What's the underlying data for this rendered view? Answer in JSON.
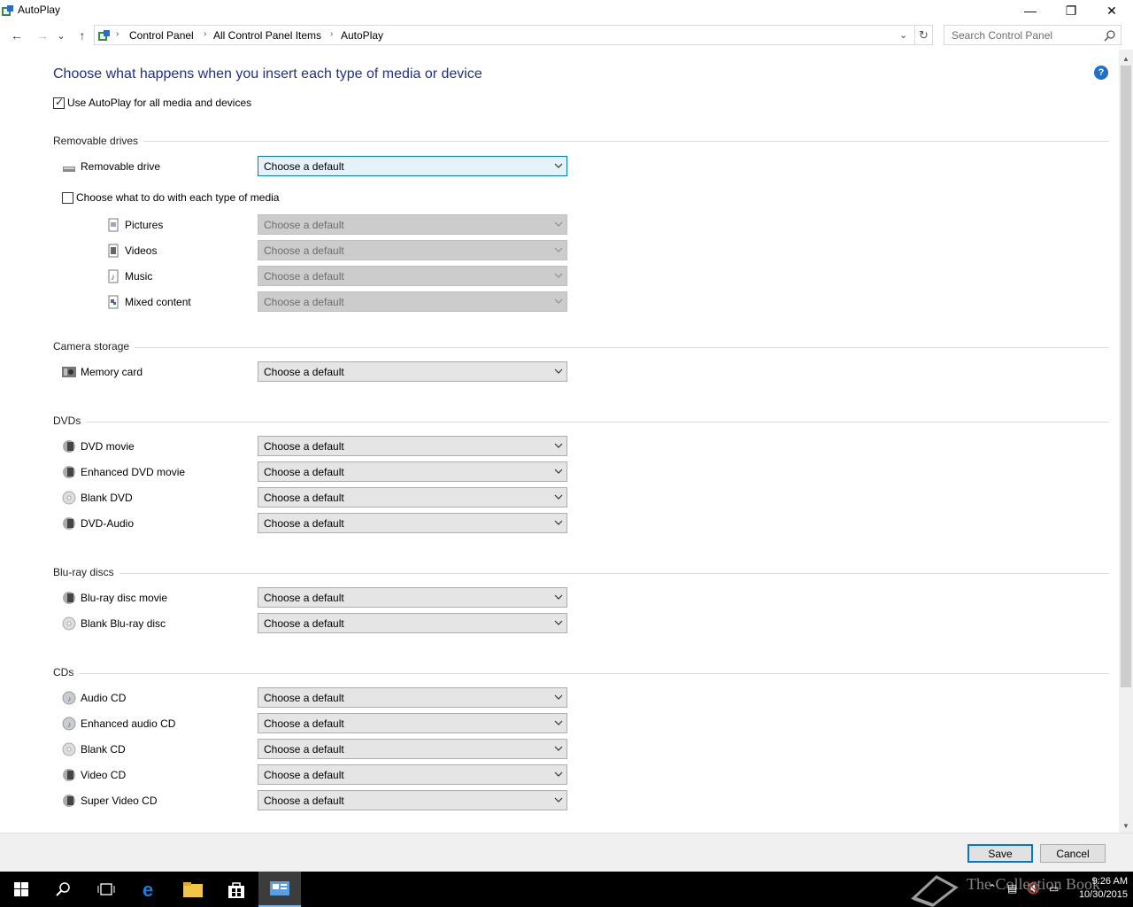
{
  "window": {
    "title": "AutoPlay",
    "minimize": "—",
    "maximize": "❐",
    "close": "✕"
  },
  "nav": {
    "back": "←",
    "forward": "→",
    "recent": "⌄",
    "up": "↑",
    "breadcrumbs": [
      "Control Panel",
      "All Control Panel Items",
      "AutoPlay"
    ],
    "refresh": "↻",
    "search_placeholder": "Search Control Panel"
  },
  "main": {
    "heading": "Choose what happens when you insert each type of media or device",
    "help": "?",
    "use_autoplay_label": "Use AutoPlay for all media and devices",
    "use_autoplay_checked": true,
    "default_text": "Choose a default"
  },
  "groups": {
    "removable": {
      "title": "Removable drives",
      "drive_label": "Removable drive",
      "media_checkbox_label": "Choose what to do with each type of media",
      "media_checkbox_checked": false,
      "media": [
        "Pictures",
        "Videos",
        "Music",
        "Mixed content"
      ]
    },
    "camera": {
      "title": "Camera storage",
      "items": [
        "Memory card"
      ]
    },
    "dvds": {
      "title": "DVDs",
      "items": [
        "DVD movie",
        "Enhanced DVD movie",
        "Blank DVD",
        "DVD-Audio"
      ]
    },
    "bluray": {
      "title": "Blu-ray discs",
      "items": [
        "Blu-ray disc movie",
        "Blank Blu-ray disc"
      ]
    },
    "cds": {
      "title": "CDs",
      "items": [
        "Audio CD",
        "Enhanced audio CD",
        "Blank CD",
        "Video CD",
        "Super Video CD"
      ]
    }
  },
  "footer": {
    "save": "Save",
    "cancel": "Cancel"
  },
  "taskbar": {
    "watermark": "The Collection Book",
    "time": "9:26 AM",
    "date": "10/30/2015"
  }
}
